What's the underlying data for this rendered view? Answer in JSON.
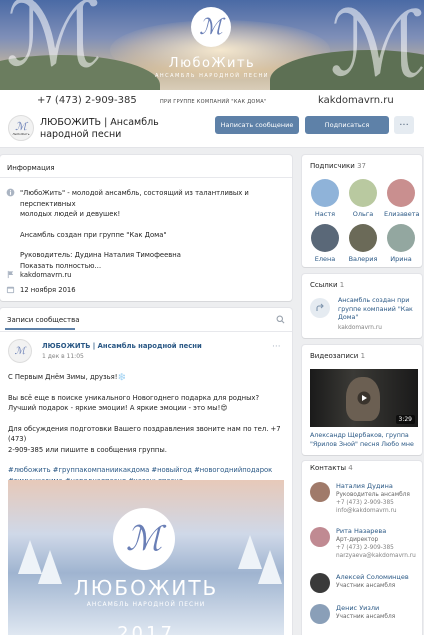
{
  "cover": {
    "brand_title": "ЛюбоЖить",
    "brand_subtitle": "АНСАМБЛЬ НАРОДНОЙ ПЕСНИ",
    "phone": "+7 (473) 2-909-385",
    "group_note": "ПРИ ГРУППЕ КОМПАНИЙ \"КАК ДОМА\"",
    "website": "kakdomavrn.ru"
  },
  "header": {
    "group_name": "ЛЮБОЖИТЬ | Ансамбль народной песни",
    "avatar_text": "ЛюбоЖить",
    "message_button": "Написать сообщение",
    "subscribe_button": "Подписаться",
    "more_button": "···"
  },
  "info": {
    "title": "Информация",
    "description_lines": [
      "\"ЛюбоЖить\" - молодой ансамбль, состоящий из талантливых и перспективных",
      "молодых людей и девушек!"
    ],
    "line2": "Ансамбль создан при группе \"Как Дома\"",
    "line3": "Руководитель: Дудина Наталия Тимофеевна",
    "show_more": "Показать полностью…",
    "site_link": "kakdomavrn.ru",
    "date": "12 ноября 2016"
  },
  "wall": {
    "title": "Записи сообщества",
    "post": {
      "author": "ЛЮБОЖИТЬ | Ансамбль народной песни",
      "time": "1 дек в 11:05",
      "greeting": "С Первым Днём Зимы, друзья!❄️",
      "p1_line1": "Вы всё еще в поиске уникального Новогоднего подарка для родных?",
      "p1_line2": "Лучший подарок - яркие эмоции! А яркие эмоции - это мы!😍",
      "p2_line1": "Для обсуждения подготовки Вашего поздравления звоните нам по тел. +7 (473)",
      "p2_line2": "2-909-385 или пишите в сообщения группы.",
      "hashtags_line1": "#любожить #группакомпаниикакдома #новыйгод #новогоднийподарок",
      "hashtags_line2": "#зимушказима #народнаяпесня #казачьяпесня",
      "image_title": "ЛЮБОЖИТЬ",
      "image_subtitle": "АНСАМБЛЬ НАРОДНОЙ ПЕСНИ",
      "image_year": "2017"
    }
  },
  "subscribers": {
    "title": "Подписчики",
    "count": "37",
    "people": [
      {
        "name": "Настя",
        "color": "#8fb3d9"
      },
      {
        "name": "Ольга",
        "color": "#b9c9a0"
      },
      {
        "name": "Елизавета",
        "color": "#c98f8f"
      },
      {
        "name": "Елена",
        "color": "#5a6878"
      },
      {
        "name": "Валерия",
        "color": "#6b6a58"
      },
      {
        "name": "Ирина",
        "color": "#93a7a0"
      }
    ]
  },
  "links": {
    "title": "Ссылки",
    "count": "1",
    "item_title_line1": "Ансамбль создан при",
    "item_title_line2": "группе компаний \"Как",
    "item_title_line3": "Дома\"",
    "item_url": "kakdomavrn.ru"
  },
  "videos": {
    "title": "Видеозаписи",
    "count": "1",
    "duration": "3:29",
    "caption_line1": "Александр Щербаков, группа",
    "caption_line2": "\"Ярилов Зной\" песня Любо мне"
  },
  "contacts": {
    "title": "Контакты",
    "count": "4",
    "items": [
      {
        "name": "Наталия Дудина",
        "role": "Руководитель ансамбля",
        "phone": "+7 (473) 2-909-385",
        "email": "info@kakdomavrn.ru",
        "color": "#a07a6a"
      },
      {
        "name": "Рита Назарева",
        "role": "Арт-директор",
        "phone": "+7 (473) 2-909-385",
        "email": "narzyaeva@kakdomavrn.ru",
        "color": "#c08a92"
      },
      {
        "name": "Алексей Соломинцев",
        "role": "Участник ансамбля",
        "phone": "",
        "email": "",
        "color": "#3a3a3a"
      },
      {
        "name": "Денис Уизли",
        "role": "Участник ансамбля",
        "phone": "",
        "email": "",
        "color": "#8a9fb8"
      }
    ]
  }
}
